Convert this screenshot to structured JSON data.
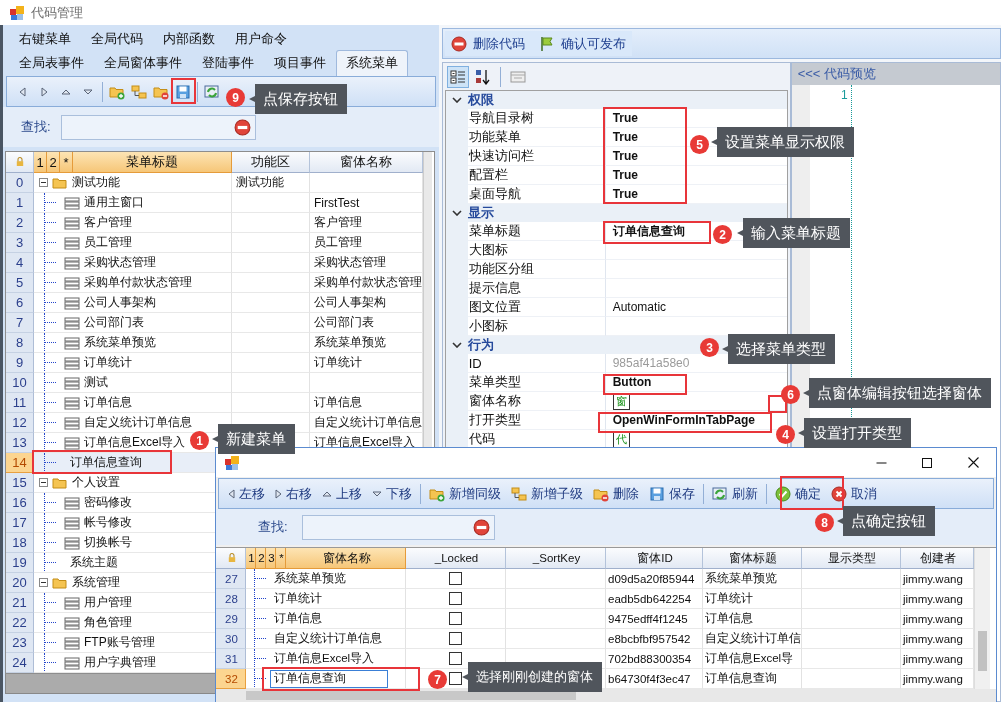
{
  "window": {
    "title": "代码管理"
  },
  "tab_rows": [
    {
      "tabs": [
        {
          "label": "右键菜单",
          "selected": false
        },
        {
          "label": "全局代码",
          "selected": false
        },
        {
          "label": "内部函数",
          "selected": false
        },
        {
          "label": "用户命令",
          "selected": false
        }
      ]
    },
    {
      "tabs": [
        {
          "label": "全局表事件",
          "selected": false
        },
        {
          "label": "全局窗体事件",
          "selected": false
        },
        {
          "label": "登陆事件",
          "selected": false
        },
        {
          "label": "项目事件",
          "selected": false
        },
        {
          "label": "系统菜单",
          "selected": true
        }
      ]
    }
  ],
  "menu_toolbar": {
    "buttons": [
      {
        "kind": "move-left"
      },
      {
        "kind": "move-right"
      },
      {
        "kind": "move-up"
      },
      {
        "kind": "move-down"
      },
      {
        "kind": "separator"
      },
      {
        "kind": "add-sibling"
      },
      {
        "kind": "add-child"
      },
      {
        "kind": "remove"
      },
      {
        "kind": "save"
      },
      {
        "kind": "separator"
      },
      {
        "kind": "refresh"
      }
    ]
  },
  "menu_search": {
    "label": "查找:"
  },
  "menu_grid": {
    "level_buttons": [
      "1",
      "2",
      "*"
    ],
    "columns": [
      {
        "label": "菜单标题",
        "selected": true
      },
      {
        "label": "功能区",
        "selected": false
      },
      {
        "label": "窗体名称",
        "selected": false
      }
    ],
    "rows": [
      {
        "number": "0",
        "title": "测试功能",
        "area": "测试功能",
        "kind": "folder",
        "expanded": true,
        "selected": false,
        "children": [
          {
            "number": "1",
            "title": "通用主窗口",
            "form": "FirstTest",
            "kind": "item",
            "selected": false
          },
          {
            "number": "2",
            "title": "客户管理",
            "form": "客户管理",
            "kind": "item",
            "selected": false
          },
          {
            "number": "3",
            "title": "员工管理",
            "form": "员工管理",
            "kind": "item",
            "selected": false
          },
          {
            "number": "4",
            "title": "采购状态管理",
            "form": "采购状态管理",
            "kind": "item",
            "selected": false
          },
          {
            "number": "5",
            "title": "采购单付款状态管理",
            "form": "采购单付款状态管理",
            "kind": "item",
            "selected": false
          },
          {
            "number": "6",
            "title": "公司人事架构",
            "form": "公司人事架构",
            "kind": "item",
            "selected": false
          },
          {
            "number": "7",
            "title": "公司部门表",
            "form": "公司部门表",
            "kind": "item",
            "selected": false
          },
          {
            "number": "8",
            "title": "系统菜单预览",
            "form": "系统菜单预览",
            "kind": "item",
            "selected": false
          },
          {
            "number": "9",
            "title": "订单统计",
            "form": "订单统计",
            "kind": "item",
            "selected": false
          },
          {
            "number": "10",
            "title": "测试",
            "kind": "item",
            "selected": false
          },
          {
            "number": "11",
            "title": "订单信息",
            "form": "订单信息",
            "kind": "item",
            "selected": false
          },
          {
            "number": "12",
            "title": "自定义统计订单信息",
            "form": "自定义统计订单信息",
            "kind": "item",
            "selected": false
          },
          {
            "number": "13",
            "title": "订单信息Excel导入",
            "form": "订单信息Excel导入",
            "kind": "item",
            "selected": false
          },
          {
            "number": "14",
            "title": "订单信息查询",
            "kind": "plain",
            "selected": true
          }
        ]
      },
      {
        "number": "15",
        "title": "个人设置",
        "kind": "folder",
        "expanded": true,
        "selected": false,
        "children": [
          {
            "number": "16",
            "title": "密码修改",
            "kind": "item",
            "selected": false
          },
          {
            "number": "17",
            "title": "帐号修改",
            "kind": "item",
            "selected": false
          },
          {
            "number": "18",
            "title": "切换帐号",
            "kind": "item",
            "selected": false
          },
          {
            "number": "19",
            "title": "系统主题",
            "kind": "plain",
            "selected": false
          }
        ]
      },
      {
        "number": "20",
        "title": "系统管理",
        "kind": "folder",
        "expanded": true,
        "selected": false,
        "children": [
          {
            "number": "21",
            "title": "用户管理",
            "kind": "item",
            "selected": false
          },
          {
            "number": "22",
            "title": "角色管理",
            "kind": "item",
            "selected": false
          },
          {
            "number": "23",
            "title": "FTP账号管理",
            "kind": "item",
            "selected": false
          },
          {
            "number": "24",
            "title": "用户字典管理",
            "kind": "item",
            "selected": false
          }
        ]
      }
    ]
  },
  "code_toolbar": {
    "buttons": [
      {
        "kind": "delete",
        "label": "删除代码"
      },
      {
        "kind": "publish",
        "label": "确认可发布"
      }
    ]
  },
  "property_grid": {
    "toolbar": [
      {
        "kind": "categorized",
        "selected": true
      },
      {
        "kind": "alphabetical",
        "selected": false
      },
      {
        "kind": "property-pages",
        "selected": false
      }
    ],
    "categories": [
      {
        "name": "权限",
        "expanded": true,
        "properties": [
          {
            "name": "导航目录树",
            "kind": "text",
            "value": "True",
            "modified": true
          },
          {
            "name": "功能菜单",
            "kind": "text",
            "value": "True",
            "modified": true
          },
          {
            "name": "快速访问栏",
            "kind": "text",
            "value": "True",
            "modified": true
          },
          {
            "name": "配置栏",
            "kind": "text",
            "value": "True",
            "modified": true
          },
          {
            "name": "桌面导航",
            "kind": "text",
            "value": "True",
            "modified": true
          }
        ]
      },
      {
        "name": "显示",
        "expanded": true,
        "properties": [
          {
            "name": "菜单标题",
            "kind": "text",
            "value": "订单信息查询",
            "modified": true
          },
          {
            "name": "大图标",
            "kind": "text",
            "modified": false
          },
          {
            "name": "功能区分组",
            "kind": "text",
            "modified": false
          },
          {
            "name": "提示信息",
            "kind": "text",
            "modified": false
          },
          {
            "name": "图文位置",
            "kind": "text",
            "value": "Automatic",
            "modified": false
          },
          {
            "name": "小图标",
            "kind": "text",
            "modified": false
          }
        ]
      },
      {
        "name": "行为",
        "expanded": true,
        "properties": [
          {
            "name": "ID",
            "kind": "readonly",
            "value": "985af41a58e0",
            "modified": false
          },
          {
            "name": "菜单类型",
            "kind": "text",
            "value": "Button",
            "modified": true
          },
          {
            "name": "窗体名称",
            "kind": "button",
            "value": "窗",
            "modified": false
          },
          {
            "name": "打开类型",
            "kind": "text",
            "value": "OpenWinFormInTabPage",
            "modified": true
          },
          {
            "name": "代码",
            "kind": "button",
            "value": "代",
            "modified": false
          }
        ]
      }
    ]
  },
  "code_preview": {
    "title": "<<< 代码预览",
    "line_numbers": [
      "1"
    ]
  },
  "dialog": {
    "toolbar": [
      {
        "kind": "move-left",
        "label": "左移"
      },
      {
        "kind": "move-right",
        "label": "右移"
      },
      {
        "kind": "move-up",
        "label": "上移"
      },
      {
        "kind": "move-down",
        "label": "下移"
      },
      {
        "kind": "separator"
      },
      {
        "kind": "add-sibling",
        "label": "新增同级"
      },
      {
        "kind": "add-child",
        "label": "新增子级"
      },
      {
        "kind": "remove",
        "label": "删除"
      },
      {
        "kind": "save",
        "label": "保存"
      },
      {
        "kind": "separator"
      },
      {
        "kind": "refresh",
        "label": "刷新"
      },
      {
        "kind": "separator"
      },
      {
        "kind": "confirm",
        "label": "确定"
      },
      {
        "kind": "cancel",
        "label": "取消"
      }
    ],
    "search": {
      "label": "查找:"
    },
    "grid": {
      "level_buttons": [
        "1",
        "2",
        "3",
        "*"
      ],
      "columns": [
        {
          "label": "窗体名称",
          "selected": true
        },
        {
          "label": "_Locked",
          "selected": false
        },
        {
          "label": "_SortKey",
          "selected": false
        },
        {
          "label": "窗体ID",
          "selected": false
        },
        {
          "label": "窗体标题",
          "selected": false
        },
        {
          "label": "显示类型",
          "selected": false
        },
        {
          "label": "创建者",
          "selected": false
        }
      ],
      "rows": [
        {
          "number": "27",
          "name": "系统菜单预览",
          "locked": false,
          "form_id": "d09d5a20f85944",
          "form_title": "系统菜单预览",
          "creator": "jimmy.wang",
          "selected": false
        },
        {
          "number": "28",
          "name": "订单统计",
          "locked": false,
          "form_id": "eadb5db642254",
          "form_title": "订单统计",
          "creator": "jimmy.wang",
          "selected": false
        },
        {
          "number": "29",
          "name": "订单信息",
          "locked": false,
          "form_id": "9475edff4f1245",
          "form_title": "订单信息",
          "creator": "jimmy.wang",
          "selected": false
        },
        {
          "number": "30",
          "name": "自定义统计订单信息",
          "locked": false,
          "form_id": "e8bcbfbf957542",
          "form_title": "自定义统计订单信",
          "creator": "jimmy.wang",
          "selected": false
        },
        {
          "number": "31",
          "name": "订单信息Excel导入",
          "locked": false,
          "form_id": "702bd88300354",
          "form_title": "订单信息Excel导",
          "creator": "jimmy.wang",
          "selected": false
        },
        {
          "number": "32",
          "name": "订单信息查询",
          "locked": false,
          "form_id": "b64730f4f3ec47",
          "form_title": "订单信息查询",
          "creator": "jimmy.wang",
          "selected": true
        }
      ]
    }
  },
  "callouts": [
    {
      "number": "9",
      "text": "点保存按钮"
    },
    {
      "number": "5",
      "text": "设置菜单显示权限"
    },
    {
      "number": "2",
      "text": "输入菜单标题"
    },
    {
      "number": "3",
      "text": "选择菜单类型"
    },
    {
      "number": "6",
      "text": "点窗体编辑按钮选择窗体"
    },
    {
      "number": "1",
      "text": "新建菜单"
    },
    {
      "number": "4",
      "text": "设置打开类型"
    },
    {
      "number": "8",
      "text": "点确定按钮"
    },
    {
      "number": "7",
      "text": "选择刚刚创建的窗体"
    }
  ]
}
